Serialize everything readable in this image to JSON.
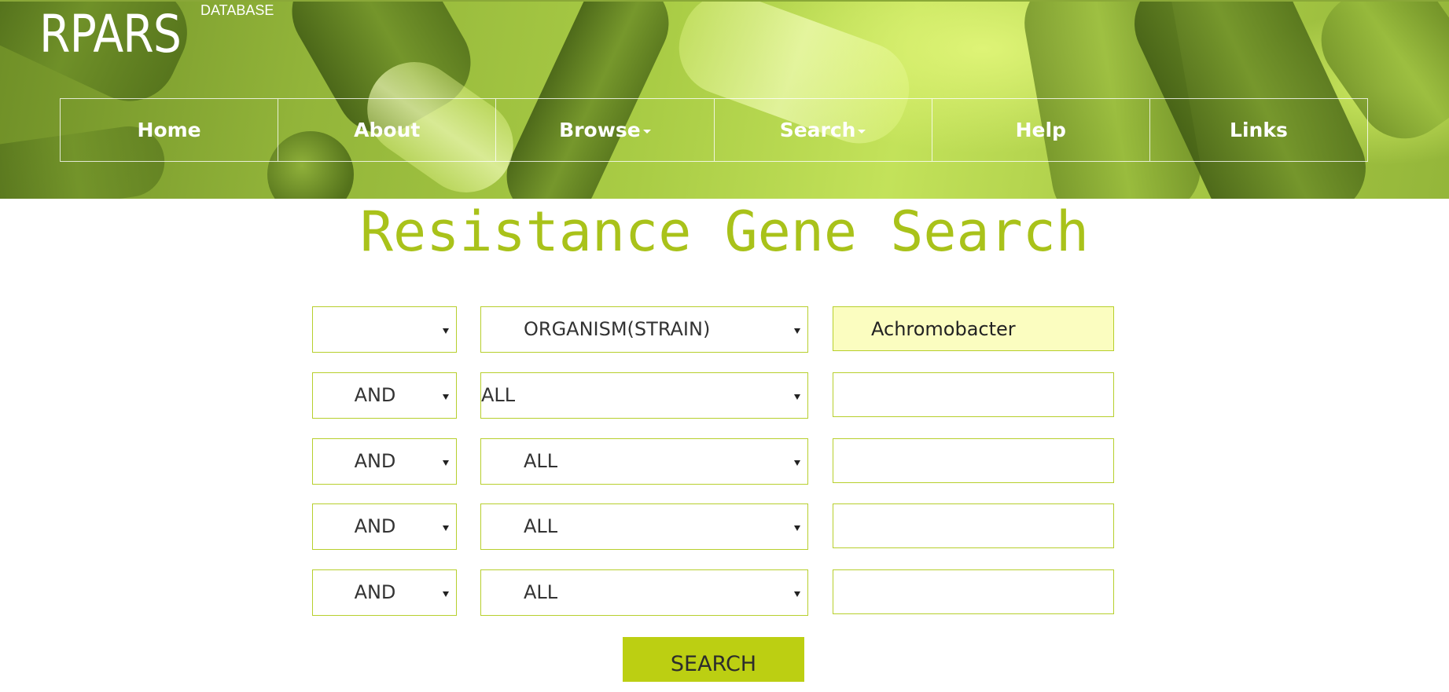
{
  "site": {
    "logo": "RPARS",
    "logo_sub": "DATABASE"
  },
  "nav": {
    "home": "Home",
    "about": "About",
    "browse": "Browse",
    "search": "Search",
    "help": "Help",
    "links": "Links"
  },
  "page": {
    "title": "Resistance Gene Search"
  },
  "form": {
    "rows": [
      {
        "operator": "",
        "field": "ORGANISM(STRAIN)",
        "value": ""
      },
      {
        "operator": "AND",
        "field": "ALL",
        "value": ""
      },
      {
        "operator": "AND",
        "field": "ALL",
        "value": ""
      },
      {
        "operator": "AND",
        "field": "ALL",
        "value": ""
      },
      {
        "operator": "AND",
        "field": "ALL",
        "value": ""
      }
    ],
    "first_value": "Achromobacter",
    "search_label": "SEARCH"
  },
  "colors": {
    "accent": "#a9c21a",
    "button": "#bccf12",
    "input_border": "#b7cf2d",
    "filled_input": "#fbfdc0"
  }
}
